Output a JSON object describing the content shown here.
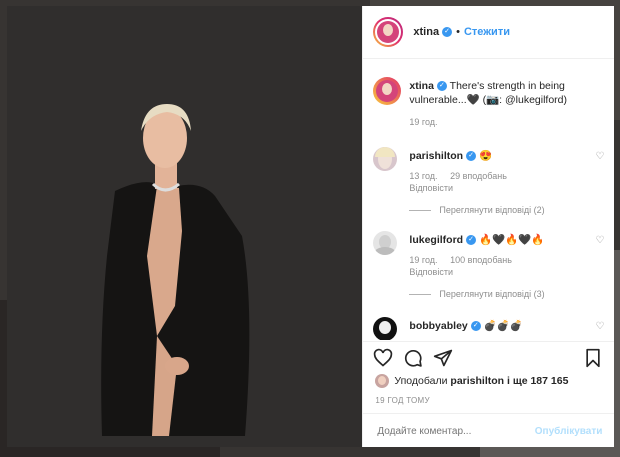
{
  "post": {
    "username": "xtina",
    "follow_label": "Стежити",
    "caption_text": "There's strength in being vulnerable...🖤 (📷: @lukegilford)",
    "caption_age": "19 год."
  },
  "comments": [
    {
      "username": "parishilton",
      "text": "😍",
      "age": "13 год.",
      "likes": "29 вподобань",
      "reply": "Відповісти",
      "view_replies": "Переглянути відповіді (2)"
    },
    {
      "username": "lukegilford",
      "text": "🔥🖤🔥🖤🔥",
      "age": "19 год.",
      "likes": "100 вподобань",
      "reply": "Відповісти",
      "view_replies": "Переглянути відповіді (3)"
    },
    {
      "username": "bobbyabley",
      "text": "💣💣💣"
    }
  ],
  "liked_by": {
    "prefix": "Уподобали",
    "user": "parishilton",
    "suffix": "і ще 187 165"
  },
  "timestamp": "19 ГОД ТОМУ",
  "comment_form": {
    "placeholder": "Додайте коментар...",
    "publish_label": "Опублікувати"
  },
  "colors": {
    "accent": "#3897f0",
    "publish_disabled": "#b2dffc",
    "muted": "#8e8e8e"
  }
}
